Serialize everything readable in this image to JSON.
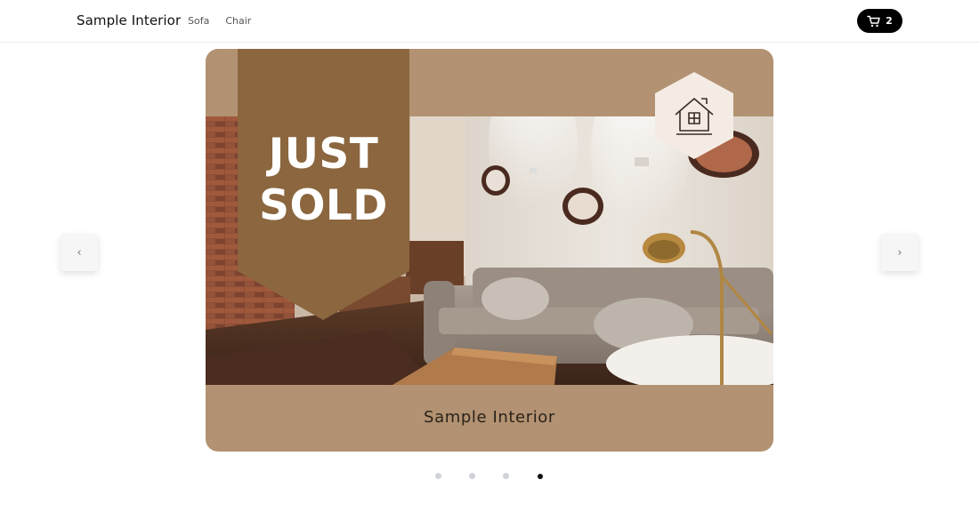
{
  "header": {
    "brand": "Sample Interior",
    "nav": [
      {
        "label": "Sofa"
      },
      {
        "label": "Chair"
      }
    ],
    "cart_count": "2"
  },
  "slider": {
    "ribbon_line1": "JUST",
    "ribbon_line2": "SOLD",
    "caption": "Sample Interior",
    "prev_label": "‹",
    "next_label": "›",
    "total_slides": 4,
    "active_slide": 4
  },
  "colors": {
    "slide_bg": "#b29272",
    "ribbon": "#8b663e",
    "cart_bg": "#000000",
    "badge_bg": "#f4ece4"
  }
}
